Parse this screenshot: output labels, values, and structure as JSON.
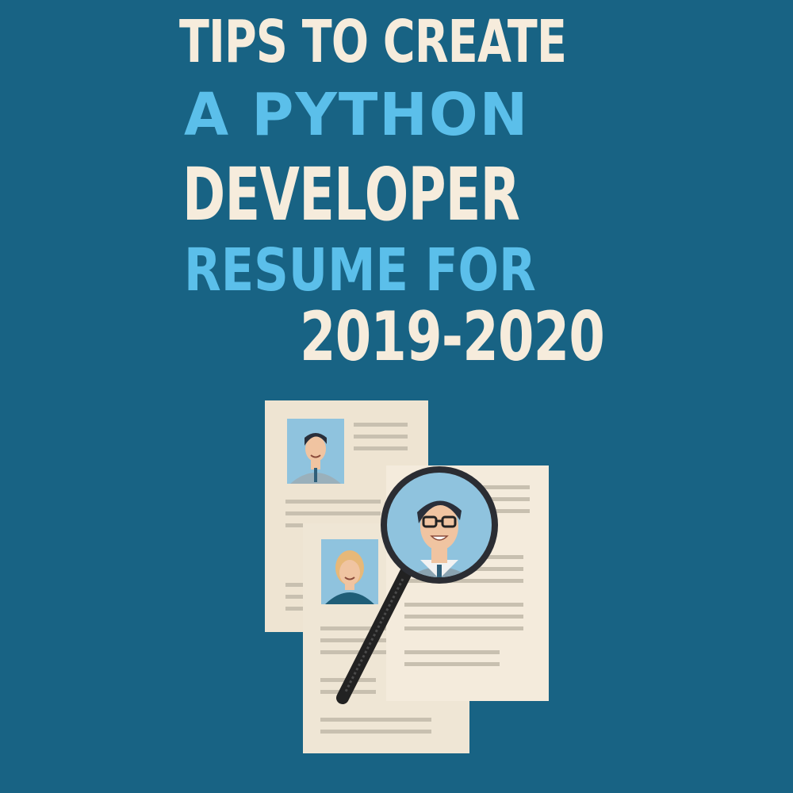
{
  "headline": {
    "line1": "TIPS TO CREATE",
    "line2": "A PYTHON",
    "line3": "DEVELOPER",
    "line4": "RESUME FOR",
    "line5": "2019-2020"
  },
  "colors": {
    "background": "#186384",
    "cream_text": "#f6ecdc",
    "blue_text": "#5bbfea"
  }
}
